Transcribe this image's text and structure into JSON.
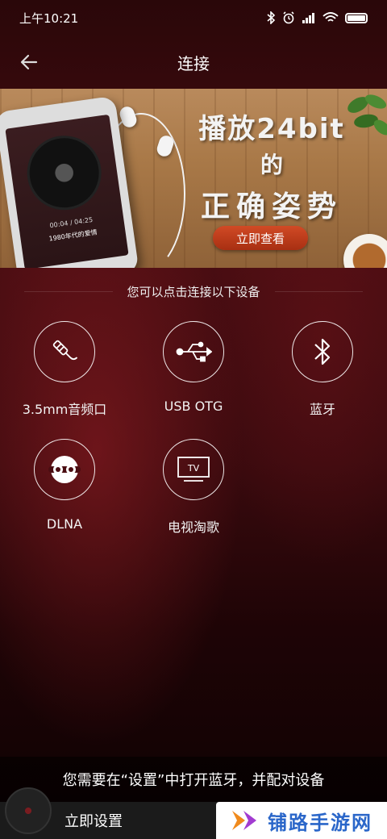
{
  "status_bar": {
    "time": "上午10:21",
    "icons": [
      "bluetooth-icon",
      "alarm-icon",
      "signal-icon",
      "wifi-icon",
      "battery-icon"
    ]
  },
  "header": {
    "title": "连接",
    "back_icon": "arrow-left-icon"
  },
  "banner": {
    "line1": "播放24bit",
    "line2": "的",
    "line3": "正确姿势",
    "cta_label": "立即查看",
    "phone_time": "00:04 / 04:25",
    "phone_song": "1980年代的爱情"
  },
  "section": {
    "title": "您可以点击连接以下设备"
  },
  "devices": [
    {
      "label": "3.5mm音频口",
      "icon": "headphone-jack-icon"
    },
    {
      "label": "USB OTG",
      "icon": "usb-icon"
    },
    {
      "label": "蓝牙",
      "icon": "bluetooth-icon"
    },
    {
      "label": "DLNA",
      "icon": "dlna-icon"
    },
    {
      "label": "电视淘歌",
      "icon": "tv-icon"
    }
  ],
  "bottom": {
    "message": "您需要在“设置”中打开蓝牙，并配对设备",
    "settings_label": "立即设置"
  },
  "watermark": {
    "text": "铺路手游网"
  },
  "colors": {
    "background": "#3a0a0e",
    "cta": "#c0401c",
    "watermark_blue": "#2a66c9",
    "watermark_orange": "#f08a1c"
  }
}
